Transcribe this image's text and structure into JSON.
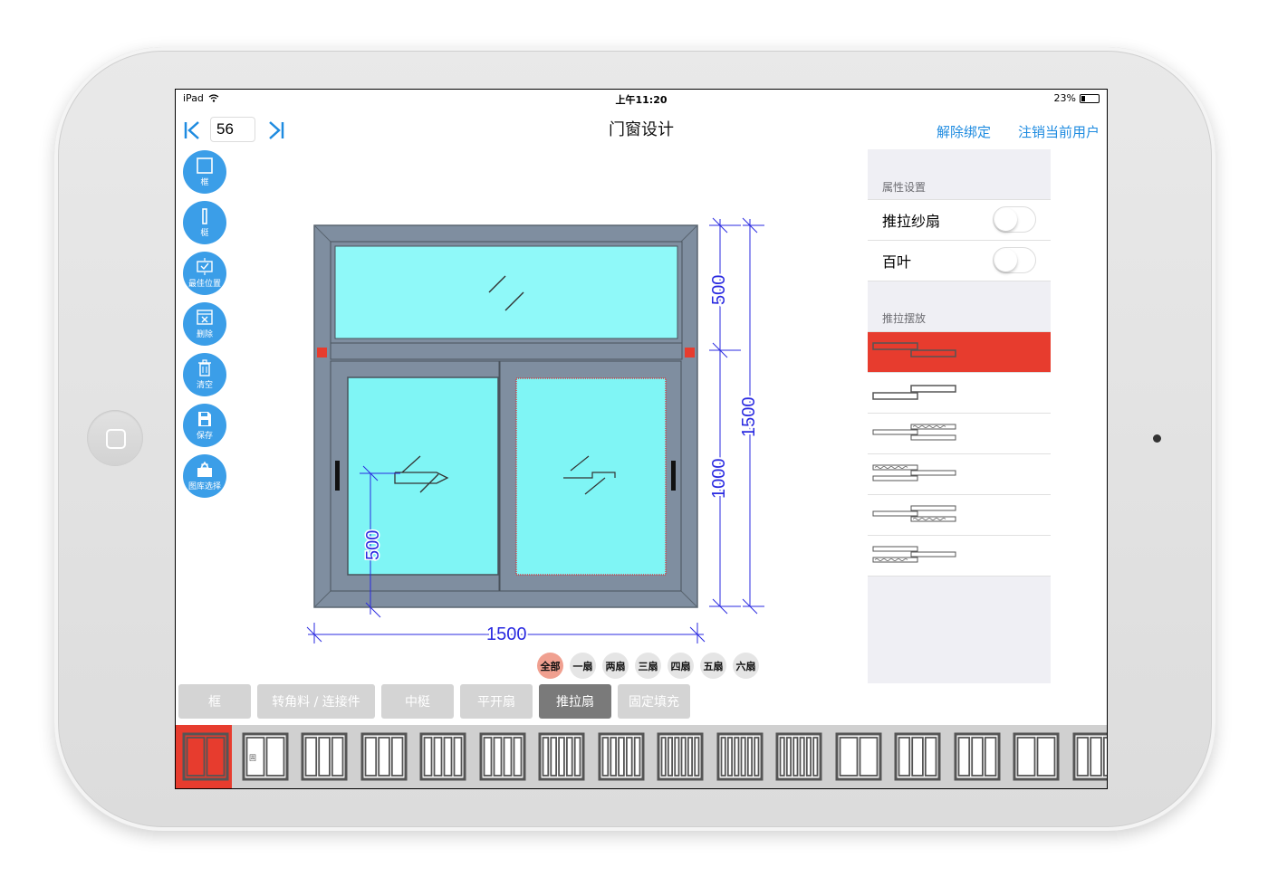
{
  "statusbar": {
    "device": "iPad",
    "time": "上午11:20",
    "battery": "23%"
  },
  "nav": {
    "page_value": "56"
  },
  "header": {
    "title": "门窗设计",
    "links": [
      "解除绑定",
      "注销当前用户"
    ]
  },
  "tools": [
    {
      "label": "框",
      "icon": "frame-icon"
    },
    {
      "label": "梃",
      "icon": "mullion-icon"
    },
    {
      "label": "最佳位置",
      "icon": "best-position-icon"
    },
    {
      "label": "删除",
      "icon": "delete-icon"
    },
    {
      "label": "清空",
      "icon": "trash-icon"
    },
    {
      "label": "保存",
      "icon": "save-icon"
    },
    {
      "label": "图库选择",
      "icon": "gallery-icon"
    }
  ],
  "drawing": {
    "dim_width": "1500",
    "dim_height_total": "1500",
    "dim_height_top": "500",
    "dim_height_bottom": "1000",
    "dim_inner": "500",
    "colors": {
      "frame": "#7f8ea0",
      "glass": "#7ff5f5",
      "dimension": "#2a2ae0",
      "marker": "#e73c2e"
    }
  },
  "chips": [
    "全部",
    "一扇",
    "两扇",
    "三扇",
    "四扇",
    "五扇",
    "六扇"
  ],
  "chips_active": 0,
  "categories": [
    {
      "label": "框",
      "width": 80
    },
    {
      "label": "转角料 / 连接件",
      "width": 130
    },
    {
      "label": "中梃",
      "width": 80
    },
    {
      "label": "平开扇",
      "width": 80
    },
    {
      "label": "推拉扇",
      "width": 80,
      "active": true
    },
    {
      "label": "固定填充",
      "width": 80
    }
  ],
  "panel": {
    "section1": "属性设置",
    "toggles": [
      {
        "label": "推拉纱扇",
        "on": false
      },
      {
        "label": "百叶",
        "on": false
      }
    ],
    "section2": "推拉摆放",
    "selected_layout": 0
  },
  "strip_fixed_label": "固",
  "accent": "#e73c2e",
  "link_color": "#1e8be0",
  "tool_color": "#3b9ee8"
}
